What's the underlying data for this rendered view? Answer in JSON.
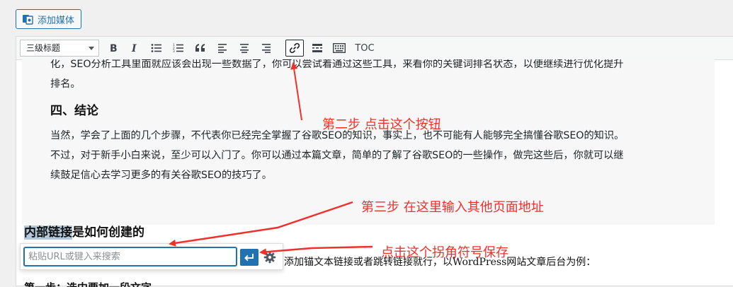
{
  "media_button": {
    "label": "添加媒体"
  },
  "toolbar": {
    "format_select": "三级标题",
    "toc_label": "TOC",
    "buttons": [
      "bold-icon",
      "italic-icon",
      "bulleted-list-icon",
      "numbered-list-icon",
      "blockquote-icon",
      "align-left-icon",
      "align-center-icon",
      "align-right-icon",
      "link-icon",
      "read-more-icon",
      "toolbar-toggle-icon"
    ]
  },
  "quote": {
    "line_top": "化，SEO分析工具里面就应该会出现一些数据了，你可以尝试着通过这些工具，来看你的关键词排名状态，以便继续进行优化提升",
    "line_top2": "排名。",
    "heading": "四、结论",
    "p1": "当然，学会了上面的几个步骤，不代表你已经完全掌握了谷歌SEO的知识，事实上，也不可能有人能够完全搞懂谷歌SEO的知识。",
    "p2": "不过，对于新手小白来说，至少可以入门了。你可以通过本篇文章，简单的了解了谷歌SEO的一些操作，做完这些后，你就可以继",
    "p3": "续鼓足信心去学习更多的有关谷歌SEO的技巧了。"
  },
  "content": {
    "heading_selected": "内部链接",
    "heading_rest": "是如何创建的",
    "after_text": "添加锚文本链接或者跳转链接就行，以WordPress网站文章后台为例：",
    "cut_text": "第一步：选中要加一段文字"
  },
  "link_popup": {
    "placeholder": "粘贴URL或键入来搜索",
    "value": ""
  },
  "annotations": {
    "step2": "第二步 点击这个按钮",
    "step3": "第三步 在这里输入其他页面地址",
    "step4": "点击这个拐角符号保存"
  },
  "colors": {
    "annotation": "#f0302a",
    "accent": "#2271b1"
  }
}
